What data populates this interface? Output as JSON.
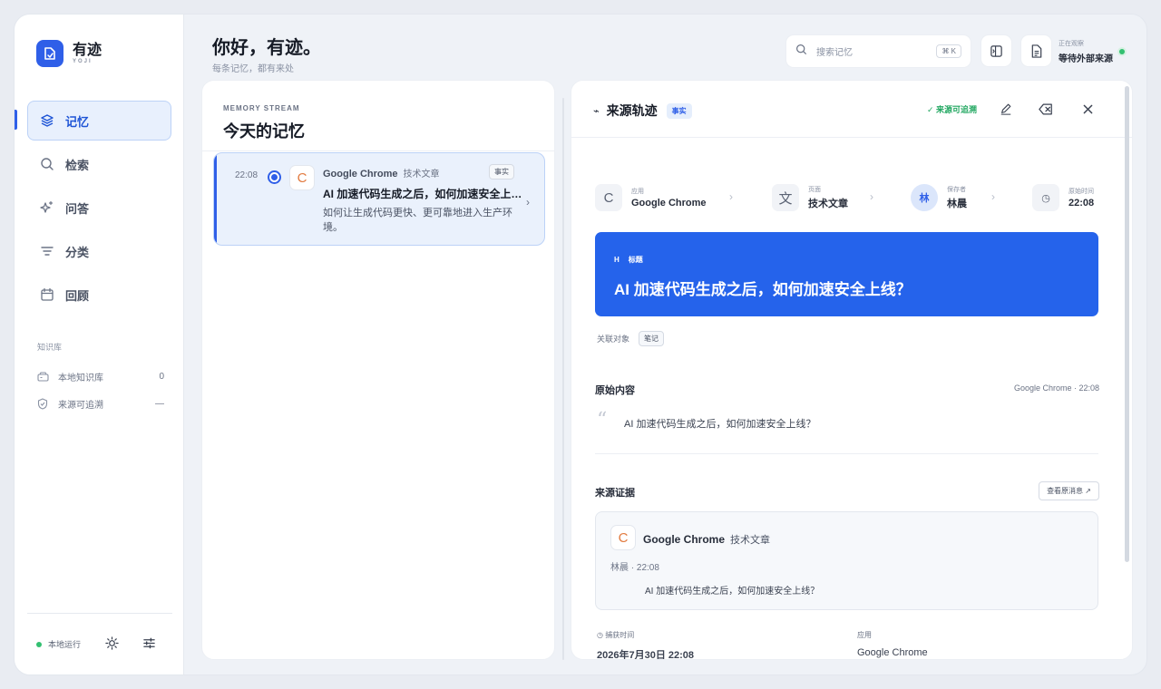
{
  "brand": {
    "name": "有迹",
    "sub": "YOJI"
  },
  "nav": [
    {
      "label": "记忆",
      "icon": "layers-icon",
      "active": true
    },
    {
      "label": "检索",
      "icon": "search-icon"
    },
    {
      "label": "问答",
      "icon": "sparkle-icon"
    },
    {
      "label": "分类",
      "icon": "filter-icon"
    },
    {
      "label": "回顾",
      "icon": "calendar-icon"
    }
  ],
  "knowledge": {
    "title": "知识库",
    "items": [
      {
        "label": "本地知识库",
        "value": "0",
        "icon": "drive-icon"
      },
      {
        "label": "来源可追溯",
        "value": "—",
        "icon": "shield-icon"
      }
    ]
  },
  "footer": {
    "status": "本地运行"
  },
  "header": {
    "greeting": "你好，有迹。",
    "subtitle": "每条记忆，都有来处",
    "search_placeholder": "搜索记忆",
    "shortcut": "⌘ K",
    "observe_label": "正在观察",
    "observe_value": "等待外部来源"
  },
  "stream": {
    "kicker": "MEMORY STREAM",
    "title": "今天的记忆",
    "card": {
      "time": "22:08",
      "app_letter": "C",
      "source": "Google Chrome",
      "category": "技术文章",
      "tag": "事实",
      "headline": "AI 加速代码生成之后，如何加速安全上线？",
      "body": "如何让生成代码更快、更可靠地进入生产环境。"
    }
  },
  "detail": {
    "title": "来源轨迹",
    "title_glyph": "⌁",
    "badge": "事实",
    "traceable": "✓ 来源可追溯",
    "meta": [
      {
        "icon": "C",
        "label": "应用",
        "value": "Google Chrome"
      },
      {
        "icon": "文",
        "label": "页面",
        "value": "技术文章"
      },
      {
        "icon": "林",
        "label": "保存者",
        "value": "林晨"
      },
      {
        "icon": "◷",
        "label": "原始时间",
        "value": "22:08"
      }
    ],
    "hero": {
      "h": "H",
      "label": "标题",
      "title": "AI 加速代码生成之后，如何加速安全上线？"
    },
    "related_label": "关联对象",
    "related_tag": "笔记",
    "original": {
      "title": "原始内容",
      "meta": "Google Chrome · 22:08",
      "quote": "AI 加速代码生成之后，如何加速安全上线？"
    },
    "evidence": {
      "title": "来源证据",
      "button": "查看原消息 ↗",
      "app_letter": "C",
      "source": "Google Chrome",
      "category": "技术文章",
      "who": "林晨 · 22:08",
      "text": "AI 加速代码生成之后，如何加速安全上线？"
    },
    "footer": [
      {
        "label": "◷ 捕获时间",
        "value": "2026年7月30日 22:08"
      },
      {
        "label": "应用",
        "value": "Google Chrome"
      }
    ]
  },
  "colors": {
    "accent": "#2f5fe8",
    "hero": "#2563eb",
    "success": "#33c071"
  }
}
